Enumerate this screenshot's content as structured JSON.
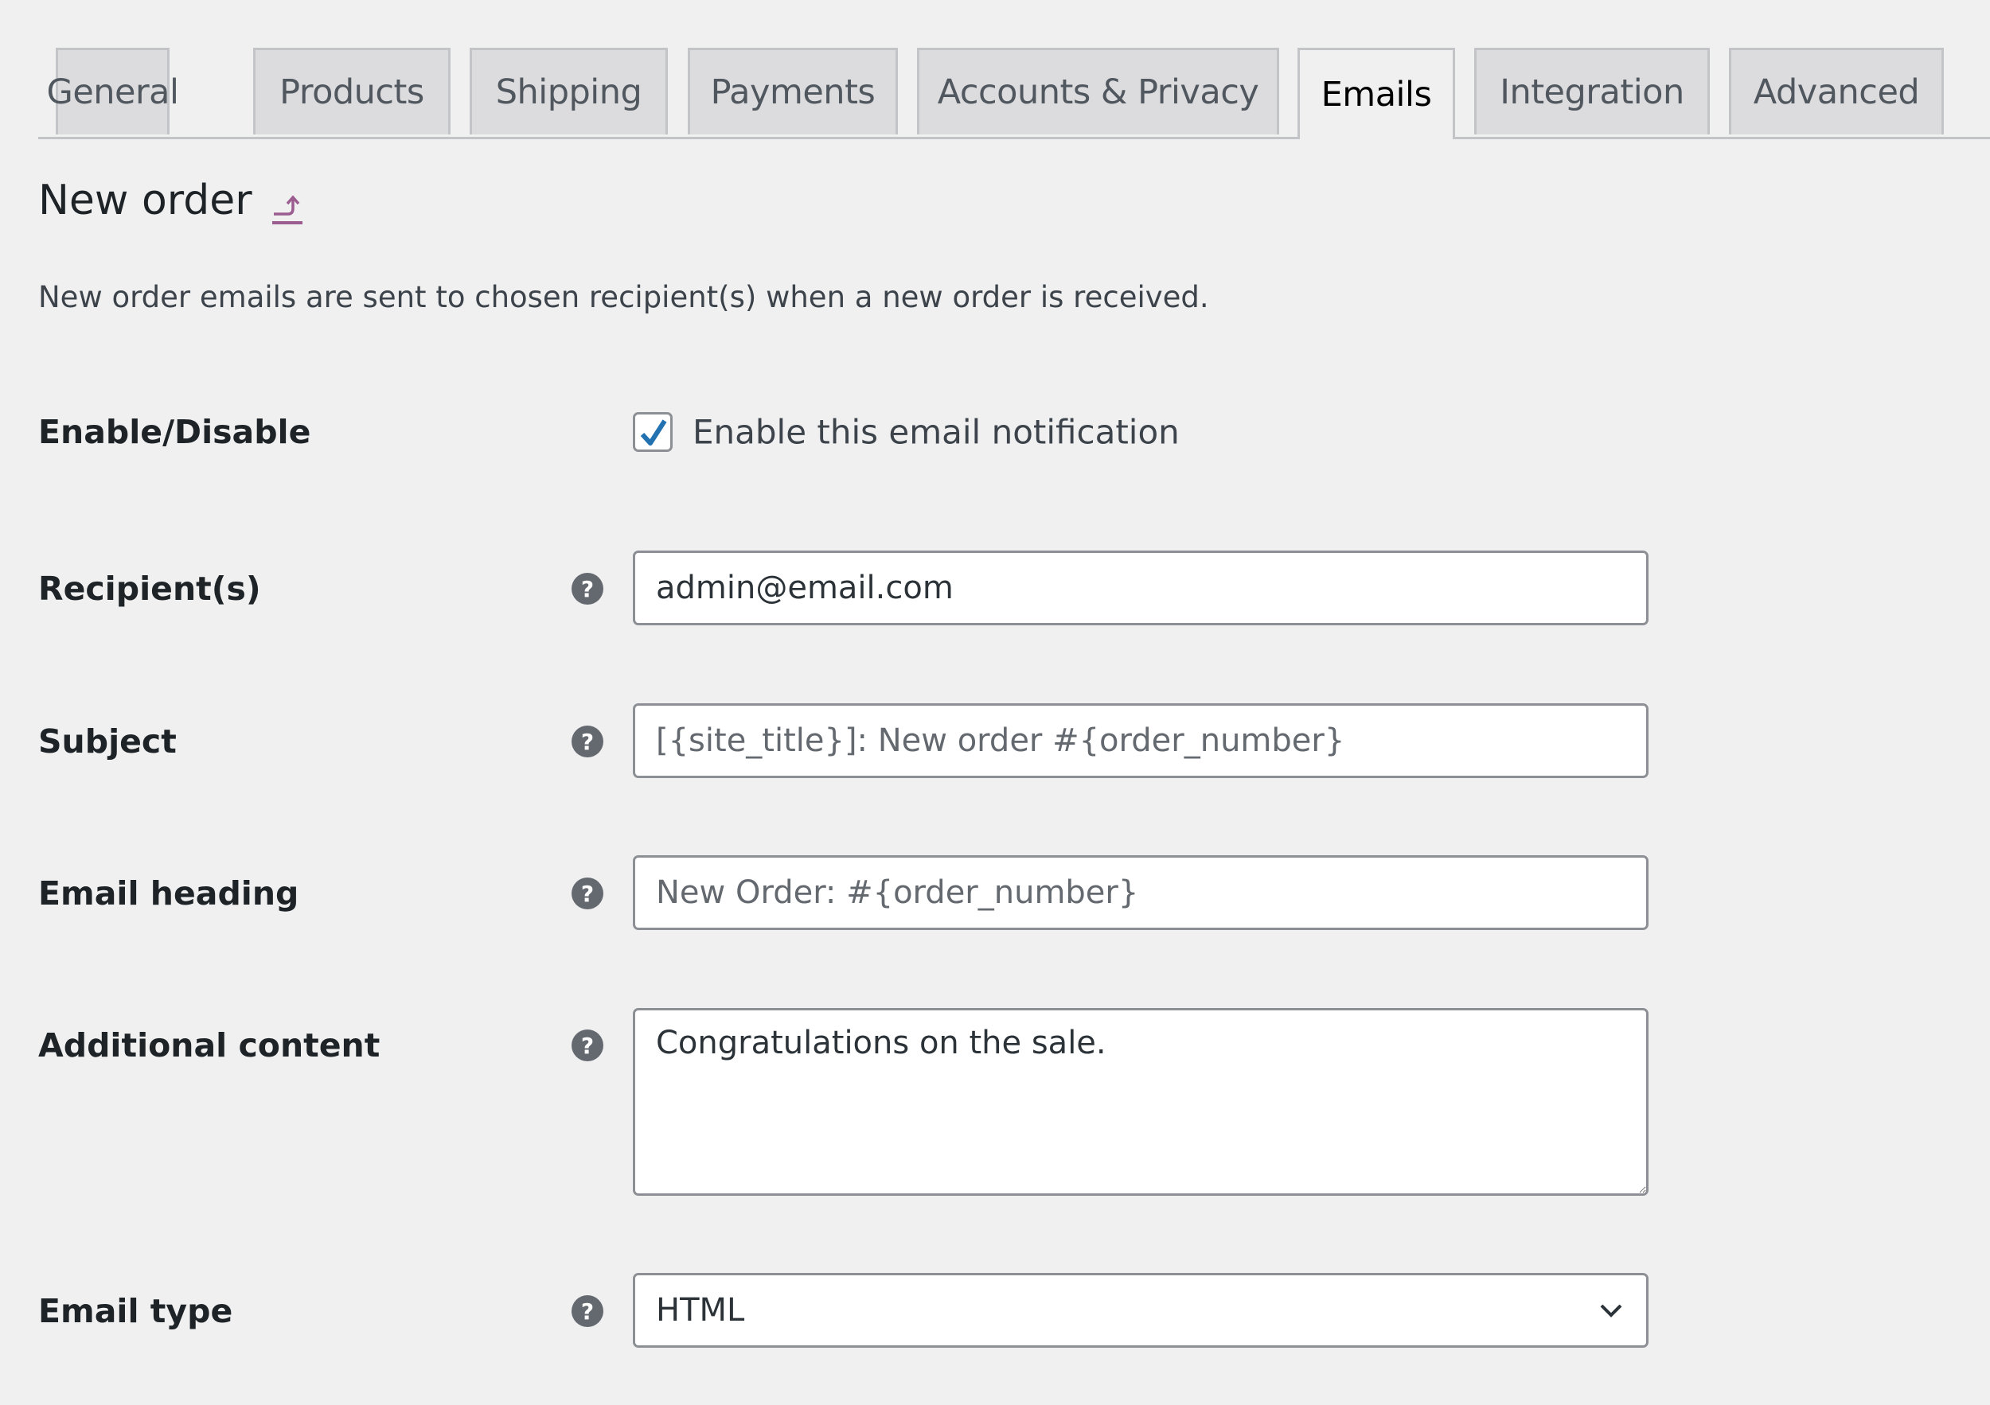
{
  "tabs": [
    {
      "label": "General",
      "active": false
    },
    {
      "label": "Products",
      "active": false
    },
    {
      "label": "Shipping",
      "active": false
    },
    {
      "label": "Payments",
      "active": false
    },
    {
      "label": "Accounts & Privacy",
      "active": false
    },
    {
      "label": "Emails",
      "active": true
    },
    {
      "label": "Integration",
      "active": false
    },
    {
      "label": "Advanced",
      "active": false
    }
  ],
  "page": {
    "title": "New order",
    "up_link_icon": "return-up-icon",
    "description": "New order emails are sent to chosen recipient(s) when a new order is received."
  },
  "form": {
    "enable": {
      "label": "Enable/Disable",
      "checkbox_label": "Enable this email notification",
      "checked": true
    },
    "recipient": {
      "label": "Recipient(s)",
      "value": "admin@email.com",
      "placeholder": ""
    },
    "subject": {
      "label": "Subject",
      "value": "",
      "placeholder": "[{site_title}]: New order #{order_number}"
    },
    "heading": {
      "label": "Email heading",
      "value": "",
      "placeholder": "New Order: #{order_number}"
    },
    "additional": {
      "label": "Additional content",
      "value": "Congratulations on the sale."
    },
    "email_type": {
      "label": "Email type",
      "selected": "HTML"
    },
    "help_icon_glyph": "?"
  },
  "colors": {
    "accent_link": "#9b5c8f",
    "checkbox_check": "#2271b1",
    "background": "#f0f0f1"
  }
}
